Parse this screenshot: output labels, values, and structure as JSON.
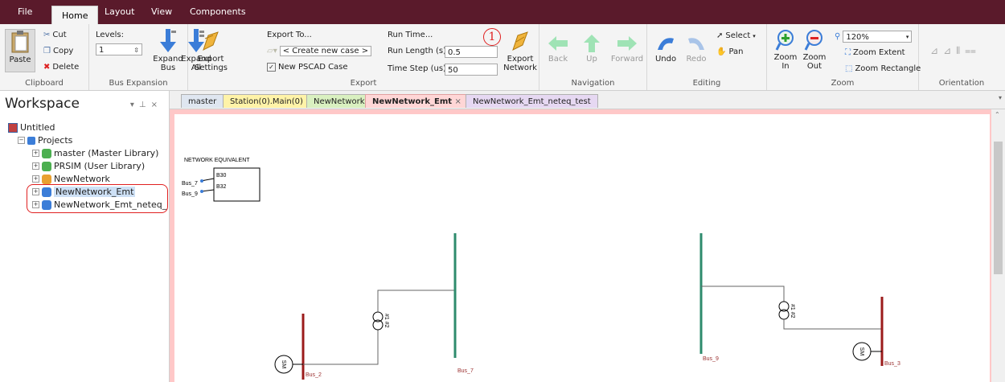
{
  "menubar": {
    "items": [
      "File",
      "Home",
      "Layout",
      "View",
      "Components"
    ],
    "active": "Home"
  },
  "clipboard": {
    "paste": "Paste",
    "cut": "Cut",
    "copy": "Copy",
    "delete": "Delete",
    "label": "Clipboard"
  },
  "bus_expansion": {
    "levels_label": "Levels:",
    "levels_value": "1",
    "expand_bus": "Expand Bus",
    "expand_all": "Expand All",
    "label": "Bus Expansion"
  },
  "export": {
    "export_settings": "Export Settings",
    "export_to": "Export To...",
    "create_case": "< Create new case >",
    "new_case_checkbox": "New PSCAD Case",
    "run_time": "Run Time...",
    "run_length_label": "Run Length (s)",
    "run_length_value": "0.5",
    "time_step_label": "Time Step (us)",
    "time_step_value": "50",
    "export_network": "Export Network",
    "label": "Export",
    "marker": "1"
  },
  "navigation": {
    "back": "Back",
    "up": "Up",
    "forward": "Forward",
    "label": "Navigation"
  },
  "editing": {
    "undo": "Undo",
    "redo": "Redo",
    "select": "Select",
    "pan": "Pan",
    "label": "Editing"
  },
  "zoom": {
    "zoom_in": "Zoom In",
    "zoom_out": "Zoom Out",
    "level": "120%",
    "zoom_extent": "Zoom Extent",
    "zoom_rectangle": "Zoom Rectangle",
    "label": "Zoom"
  },
  "orientation": {
    "label": "Orientation"
  },
  "workspace": {
    "title": "Workspace",
    "tree": [
      {
        "label": "Untitled",
        "level": 0
      },
      {
        "label": "Projects",
        "level": 1
      },
      {
        "label": "master (Master Library)",
        "level": 2
      },
      {
        "label": "PRSIM (User Library)",
        "level": 2
      },
      {
        "label": "NewNetwork",
        "level": 2
      },
      {
        "label": "NewNetwork_Emt",
        "level": 2,
        "selected": true
      },
      {
        "label": "NewNetwork_Emt_neteq_",
        "level": 2
      }
    ]
  },
  "tabs": [
    {
      "label": "master",
      "color": "#dfe6f0"
    },
    {
      "label": "Station(0).Main(0)",
      "color": "#fff3a8"
    },
    {
      "label": "NewNetwork",
      "color": "#d9f0c0"
    },
    {
      "label": "NewNetwork_Emt",
      "color": "#ffd6d6",
      "active": true,
      "close": "×"
    },
    {
      "label": "NewNetwork_Emt_neteq_test",
      "color": "#e6d8f2"
    }
  ],
  "diagram": {
    "equivalent_title": "NETWORK EQUIVALENT",
    "eq_ports": [
      "B30",
      "B32"
    ],
    "eq_buses": [
      "Bus_7",
      "Bus_9"
    ],
    "bus_labels": {
      "bus2": "Bus_2",
      "bus7": "Bus_7",
      "bus9": "Bus_9",
      "bus3": "Bus_3"
    },
    "transformer1": "#1 #2",
    "transformer2": "#1 #2",
    "machine": "SM"
  },
  "colors": {
    "menubar": "#5a1a2b",
    "bus_red": "#9b1b1b",
    "bus_green": "#2e8b6d",
    "annotation": "#e02020"
  }
}
